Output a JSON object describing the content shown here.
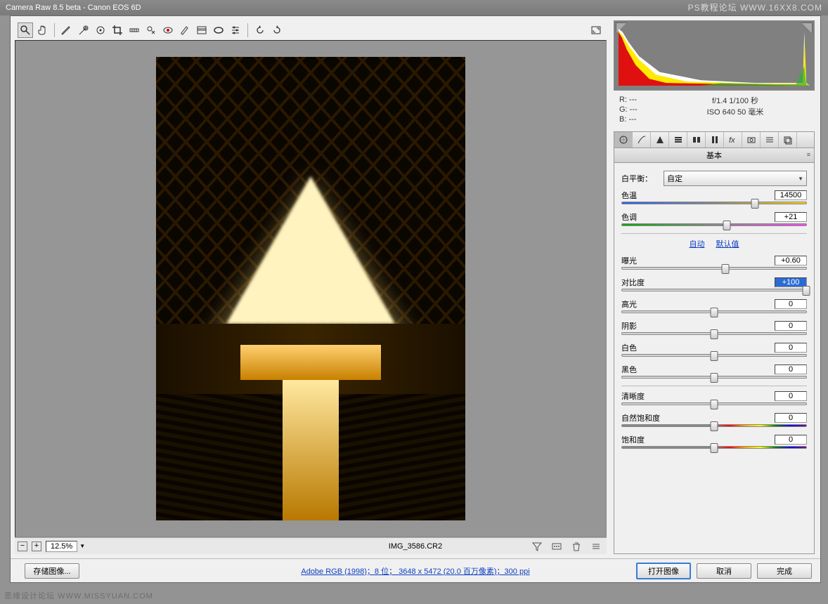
{
  "title": "Camera Raw 8.5 beta  -  Canon EOS 6D",
  "watermark_top": "PS教程论坛 WWW.16XX8.COM",
  "watermark_bottom": "思缘设计论坛  WWW.MISSYUAN.COM",
  "toolbar_icons": [
    "zoom",
    "hand",
    "eyedropper",
    "sampler",
    "target",
    "crop",
    "straighten",
    "spot",
    "redeye",
    "brush",
    "grad",
    "radial",
    "prefs",
    "rotate-ccw",
    "rotate-cw"
  ],
  "zoom": "12.5%",
  "filename": "IMG_3586.CR2",
  "meta_link": "Adobe RGB (1998)；8 位； 3648 x 5472 (20.0 百万像素)；300 ppi",
  "save_image_btn": "存储图像...",
  "rgb": {
    "r": "R:  ---",
    "g": "G:  ---",
    "b": "B:  ---"
  },
  "exif": {
    "line1": "f/1.4  1/100 秒",
    "line2": "ISO 640  50 毫米"
  },
  "panel_title": "基本",
  "wb_label": "白平衡：",
  "wb_value": "自定",
  "links": {
    "auto": "自动",
    "default": "默认值"
  },
  "sliders": {
    "temp": {
      "label": "色温",
      "value": "14500",
      "pos": 72
    },
    "tint": {
      "label": "色调",
      "value": "+21",
      "pos": 57
    },
    "exposure": {
      "label": "曝光",
      "value": "+0.60",
      "pos": 56
    },
    "contrast": {
      "label": "对比度",
      "value": "+100",
      "pos": 100,
      "selected": true
    },
    "highlights": {
      "label": "高光",
      "value": "0",
      "pos": 50
    },
    "shadows": {
      "label": "阴影",
      "value": "0",
      "pos": 50
    },
    "whites": {
      "label": "白色",
      "value": "0",
      "pos": 50
    },
    "blacks": {
      "label": "黑色",
      "value": "0",
      "pos": 50
    },
    "clarity": {
      "label": "清晰度",
      "value": "0",
      "pos": 50
    },
    "vibrance": {
      "label": "自然饱和度",
      "value": "0",
      "pos": 50
    },
    "saturation": {
      "label": "饱和度",
      "value": "0",
      "pos": 50
    }
  },
  "buttons": {
    "open": "打开图像",
    "cancel": "取消",
    "done": "完成"
  }
}
